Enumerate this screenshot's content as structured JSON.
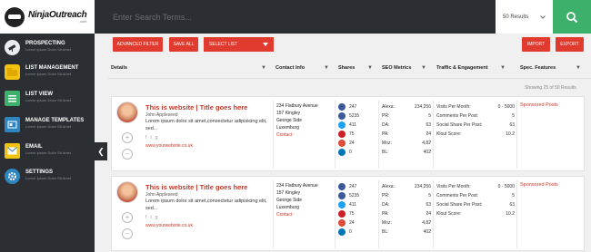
{
  "app": {
    "logo_title": "NinjaOutreach",
    "logo_sub": ".com"
  },
  "header": {
    "search_placeholder": "Enter Search Terms...",
    "results_label": "50 Results",
    "dropdown_icon": "chevron-down-icon",
    "search_icon": "search-icon"
  },
  "sidebar": {
    "items": [
      {
        "label": "PROSPECTING",
        "sub": "Lorem Ipsum Dolor Sit Amet",
        "icon": "telescope-icon",
        "color": "#e8ecef"
      },
      {
        "label": "LIST MANAGEMENT",
        "sub": "Lorem Ipsum Dolor Sit Amet",
        "icon": "folder-icon",
        "color": "#f1c40f"
      },
      {
        "label": "LIST VIEW",
        "sub": "Lorem Ipsum Dolor Sit Amet",
        "icon": "list-icon",
        "color": "#3db16b"
      },
      {
        "label": "MANAGE TEMPLATES",
        "sub": "Lorem Ipsum Dolor Sit Amet",
        "icon": "template-icon",
        "color": "#2e86c1"
      },
      {
        "label": "EMAIL",
        "sub": "Lorem Ipsum Dolor Sit Amet",
        "icon": "email-icon",
        "color": "#f1c40f"
      },
      {
        "label": "SETTINGS",
        "sub": "Lorem Ipsum Dolor Sit Amet",
        "icon": "gear-icon",
        "color": "#2e86c1"
      }
    ],
    "collapse_glyph": "❮"
  },
  "toolbar": {
    "advanced_filter": "ADVANCED FILTER",
    "save_all": "SAVE ALL",
    "select_list": "SELECT LIST",
    "import": "IMPORT",
    "export": "EXPORT",
    "accent": "#e13a2f"
  },
  "columns": {
    "details": "Details",
    "contact": "Contact Info",
    "shares": "Shares",
    "seo": "SEO Metrics",
    "traffic": "Traffic & Engagement",
    "features": "Spec. Features",
    "filter_glyph": "▼"
  },
  "showing": "Showing 25 of 50 Results",
  "rows": [
    {
      "title": "This is website | Title goes here",
      "author": "John Appleseed",
      "desc": "Lorem ipsum dolor sit amet,consectetur adipisicing elit, sed...",
      "link": "www.yourwebsite.co.uk",
      "socials": [
        "f",
        "t",
        "g"
      ],
      "address": [
        "234 Flatbury Avenue",
        "157 Kingley",
        "George Side",
        "Luxemburg"
      ],
      "contact": "Contact",
      "shares": [
        "247",
        "5235",
        "411",
        "75",
        "24",
        "0"
      ],
      "seo": [
        [
          "Alexa:",
          "234,256"
        ],
        [
          "PR:",
          "5"
        ],
        [
          "DA:",
          "63"
        ],
        [
          "PA:",
          "24"
        ],
        [
          "Moz:",
          "4,82"
        ],
        [
          "BL:",
          "402"
        ]
      ],
      "traffic": [
        [
          "Visits Per Month:",
          "0 - 5000"
        ],
        [
          "Comments Per Post:",
          "5"
        ],
        [
          "Social Share Per Post:",
          "63"
        ],
        [
          "Klout Score:",
          "10.2"
        ]
      ],
      "feature": "Sponsored Posts"
    },
    {
      "title": "This is website | Title goes here",
      "author": "John Appleseed",
      "desc": "Lorem ipsum dolor sit amet,consectetur adipisicing elit, sed...",
      "link": "www.yourwebsite.co.uk",
      "socials": [
        "f",
        "t",
        "g"
      ],
      "address": [
        "234 Flatbury Avenue",
        "157 Kingley",
        "George Side",
        "Luxemburg"
      ],
      "contact": "Contact",
      "shares": [
        "247",
        "5235",
        "411",
        "75",
        "24",
        "0"
      ],
      "seo": [
        [
          "Alexa:",
          "234,256"
        ],
        [
          "PR:",
          "5"
        ],
        [
          "DA:",
          "63"
        ],
        [
          "PA:",
          "24"
        ],
        [
          "Moz:",
          "4,82"
        ],
        [
          "BL:",
          "402"
        ]
      ],
      "traffic": [
        [
          "Visits Per Month:",
          "0 - 5000"
        ],
        [
          "Comments Per Post:",
          "5"
        ],
        [
          "Social Share Per Post:",
          "63"
        ],
        [
          "Klout Score:",
          "10.2"
        ]
      ],
      "feature": "Sponsored Posts"
    }
  ],
  "share_icons": [
    {
      "icon": "facebook-icon",
      "color": "#3b5998"
    },
    {
      "icon": "like-icon",
      "color": "#3b5998"
    },
    {
      "icon": "twitter-icon",
      "color": "#1da1f2"
    },
    {
      "icon": "pinterest-icon",
      "color": "#cb2027"
    },
    {
      "icon": "google-plus-icon",
      "color": "#dd4b39"
    },
    {
      "icon": "linkedin-icon",
      "color": "#0077b5"
    }
  ]
}
